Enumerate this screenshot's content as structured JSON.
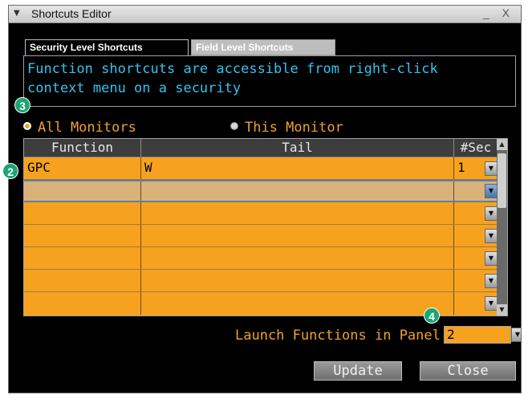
{
  "window": {
    "title": "Shortcuts Editor",
    "menu_icon": "triangle-down-icon",
    "controls": "_ X"
  },
  "tabs": [
    {
      "label": "Security Level Shortcuts",
      "active": true
    },
    {
      "label": "Field Level Shortcuts",
      "active": false
    }
  ],
  "info": {
    "line1": "Function shortcuts are accessible from right-click",
    "line2": "context menu on a security"
  },
  "callouts": {
    "c2": "2",
    "c3": "3",
    "c4": "4"
  },
  "radios": {
    "all": {
      "label": "All Monitors",
      "selected": true
    },
    "this": {
      "label": "This Monitor",
      "selected": false
    }
  },
  "grid": {
    "columns": [
      "Function",
      "Tail",
      "#Sec"
    ],
    "rows": [
      {
        "function": "GPC",
        "tail": "W",
        "sec": "1"
      },
      {
        "function": "",
        "tail": "",
        "sec": ""
      },
      {
        "function": "",
        "tail": "",
        "sec": ""
      },
      {
        "function": "",
        "tail": "",
        "sec": ""
      },
      {
        "function": "",
        "tail": "",
        "sec": ""
      },
      {
        "function": "",
        "tail": "",
        "sec": ""
      },
      {
        "function": "",
        "tail": "",
        "sec": ""
      }
    ]
  },
  "launch": {
    "label": "Launch Functions in Panel",
    "value": "2"
  },
  "buttons": {
    "update": "Update",
    "close": "Close"
  },
  "colors": {
    "amber": "#f7a21f",
    "cyan": "#34c3f1",
    "callout_green": "#1aa574"
  }
}
